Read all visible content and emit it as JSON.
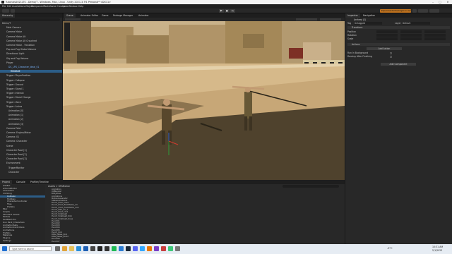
{
  "title_bar": {
    "title": "Tutorials2021LTS - Demo/T - Windows, Mac, Linux - Unity 2021.3.7f1 Personal* <DX11>",
    "minimize": "–",
    "maximize": "□",
    "close": "✕"
  },
  "menu": [
    "File",
    "Edit",
    "Assets",
    "GameObject",
    "Component",
    "Tools",
    "Game Creator",
    "Jobs",
    "Window",
    "Help"
  ],
  "toolbar": {
    "play": "▶",
    "pause": "❚❚",
    "step": "▶|",
    "layout_label": "Experimental Packages In Use ▾"
  },
  "hierarchy": {
    "tab": "Hierarchy",
    "items": [
      "Demo/T",
      "Main Camera",
      "Camera Motor",
      "Camera Motor Alt",
      "Camera Motor Alt Crouched",
      "Camera Motor - Transition",
      "Pop and Fog Global Volume",
      "Directional Light",
      "Sky and Fog Volume",
      "Player",
      "DC_LPG_Character_Ideal_01",
      "RIGBASE",
      "Trigger: PlayerPosition",
      "Trigger: Collapse",
      "Trigger: Ground",
      "Trigger: Stand 1",
      "Trigger: Interact",
      "Trigger: Stand Change",
      "Trigger: Voice",
      "Trigger: Anims",
      "Animation [0]",
      "Animation [1]",
      "Animation [2]",
      "Animation [3]",
      "Camera Field",
      "Camera: Engine/Motor",
      "Camera: 01",
      "Camera: Character",
      "Scene",
      "Character Root [1]",
      "Character Root [2]",
      "Character Root [3]",
      "Environment",
      "TriggerMonitor",
      "Character"
    ]
  },
  "scene_tabs": [
    "Scene",
    "Animator Editor",
    "Game",
    "Package Manager",
    "Animator"
  ],
  "inspector": {
    "tabs": [
      "Inspector",
      "Navigation"
    ],
    "object_name": "Archery (1)",
    "tag_label": "Tag",
    "tag_value": "Untagged",
    "layer_label": "Layer",
    "layer_value": "Default",
    "transform_title": "Transform",
    "position_label": "Position",
    "rotation_label": "Rotation",
    "scale_label": "Scale",
    "actions_title": "Actions",
    "add_action": "Add Action",
    "run_background": "Run In Background",
    "destroy_after": "Destroy After Finishing",
    "add_component": "Add Component"
  },
  "project": {
    "tabs": [
      "Project",
      "Console",
      "Profiler/Timeline"
    ],
    "folders": [
      "GTAExt",
      "GTAUnitEditor",
      "Characters",
      "Climbing",
      "Collision",
      "Hobbies",
      "CharacterController",
      "Tiles",
      "Prefabs",
      "Misc",
      "Scripts",
      "Standard Assets",
      "Models",
      "TextMesh Pro",
      "Gun Pack_Characters",
      "AnimationSets",
      "AnimationControllers",
      "Animations",
      "Prefabs",
      "Materials",
      "Plugins",
      "Settings"
    ],
    "breadcrumb": "Assets > GTAMotion",
    "files": [
      "Animation",
      "UI/Blender",
      "BodyPose",
      "Animations",
      "MotionGenerator",
      "StateAnimations",
      "Punch_From_Front",
      "Punch_Front_Fromflame_rm",
      "Punch_Front_Fromflame_rm2",
      "Punch_D01_rm_1",
      "Punch_Front_rm2",
      "Punch_Sidehead",
      "Punch_Sidehead_Kick",
      "Punch_Sidehead_Knee",
      "Punch01",
      "Punch02",
      "Punch03",
      "Punch04",
      "Punch05",
      "Punch_Kick",
      "Rifle_Melee_Kick",
      "Rifle_Melee_Kick2",
      "Punch06",
      "Punch07"
    ]
  },
  "taskbar": {
    "search_placeholder": "Type here to search",
    "temp": "-3°C",
    "time": "10:31 AM",
    "date": "2/1/2023"
  },
  "colors": {
    "accent_orange": "#c0731f",
    "selection": "#2c5d87",
    "sand": "#d6b98a",
    "shadow": "#3a3020"
  }
}
